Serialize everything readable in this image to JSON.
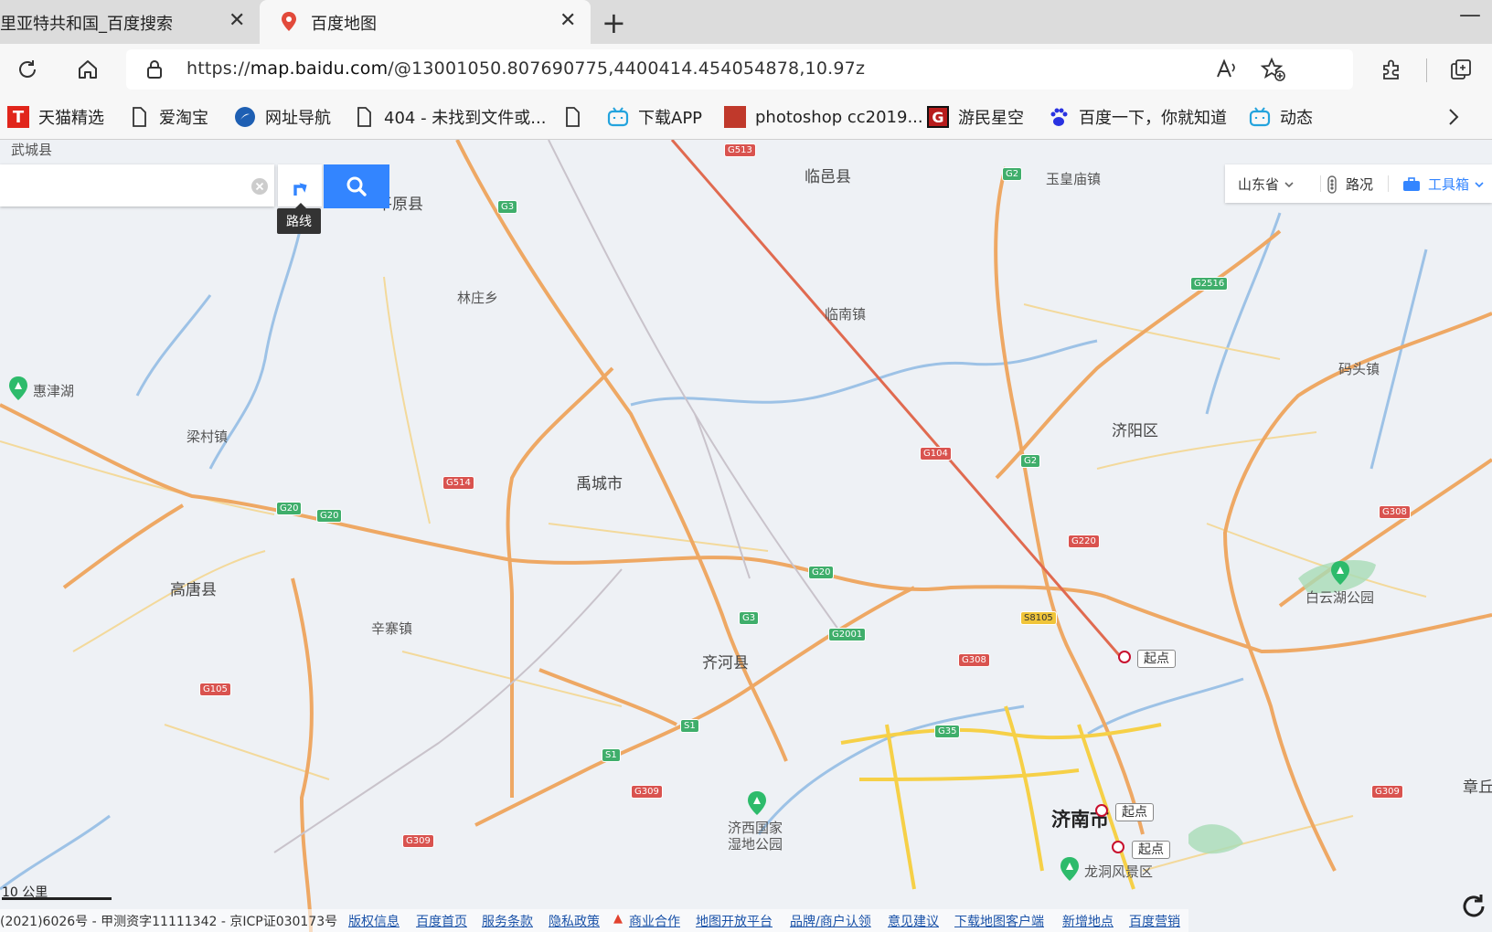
{
  "browser": {
    "tabs": [
      {
        "title": "里亚特共和国_百度搜索",
        "active": false
      },
      {
        "title": "百度地图",
        "active": true
      }
    ],
    "address": {
      "url_prefix": "https://",
      "url_host": "map.baidu.com",
      "url_path": "/@13001050.807690775,4400414.454054878,10.97z"
    },
    "bookmarks": [
      {
        "label": "天猫精选",
        "icon": "tmall-icon"
      },
      {
        "label": "爱淘宝",
        "icon": "page-icon"
      },
      {
        "label": "网址导航",
        "icon": "navigation-icon"
      },
      {
        "label": "404 - 未找到文件或...",
        "icon": "page-icon"
      },
      {
        "label": "",
        "icon": "page-icon"
      },
      {
        "label": "下载APP",
        "icon": "bilibili-icon"
      },
      {
        "label": "photoshop cc2019...",
        "icon": "seal-icon"
      },
      {
        "label": "游民星空",
        "icon": "gamersky-icon"
      },
      {
        "label": "百度一下，你就知道",
        "icon": "baidu-paw-icon"
      },
      {
        "label": "动态",
        "icon": "bilibili-icon"
      }
    ]
  },
  "map": {
    "search": {
      "placeholder": "",
      "route_tooltip": "路线"
    },
    "controls": {
      "region": "山东省",
      "traffic": "路况",
      "toolbox": "工具箱"
    },
    "places": [
      {
        "name": "武城县"
      },
      {
        "name": "平原县"
      },
      {
        "name": "临邑县"
      },
      {
        "name": "玉皇庙镇"
      },
      {
        "name": "林庄乡"
      },
      {
        "name": "临南镇"
      },
      {
        "name": "惠津湖"
      },
      {
        "name": "码头镇"
      },
      {
        "name": "济阳区"
      },
      {
        "name": "梁村镇"
      },
      {
        "name": "禹城市"
      },
      {
        "name": "高唐县"
      },
      {
        "name": "辛寨镇"
      },
      {
        "name": "齐河县"
      },
      {
        "name": "白云湖公园"
      },
      {
        "name": "济西国家湿地公园"
      },
      {
        "name": "济南市"
      },
      {
        "name": "章丘"
      },
      {
        "name": "龙洞风景区"
      }
    ],
    "roads": [
      "G513",
      "G3",
      "G2",
      "G2516",
      "G104",
      "G2",
      "G514",
      "G20",
      "G20",
      "G220",
      "G308",
      "G20",
      "G3",
      "G2001",
      "S8105",
      "G308",
      "G105",
      "S1",
      "S1",
      "G35",
      "G309",
      "G309",
      "G309"
    ],
    "markers": [
      "起点",
      "起点",
      "起点"
    ],
    "scale": "10 公里"
  },
  "footer": {
    "copyright": "(2021)6026号 - 甲测资字11111342 - 京ICP证030173号",
    "links": [
      "版权信息",
      "百度首页",
      "服务条款",
      "隐私政策",
      "商业合作",
      "地图开放平台",
      "品牌/商户认领",
      "意见建议",
      "下载地图客户端",
      "新增地点",
      "百度营销"
    ]
  }
}
